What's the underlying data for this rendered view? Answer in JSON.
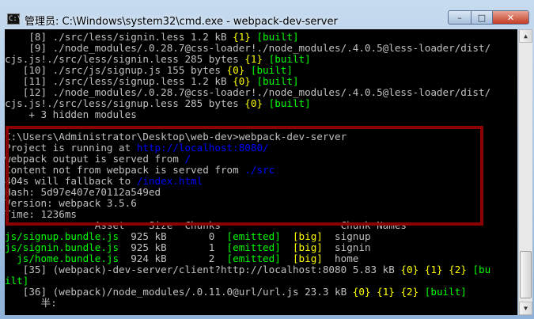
{
  "window": {
    "title": "管理员: C:\\Windows\\system32\\cmd.exe - webpack-dev-server"
  },
  "controls": {
    "minimize": "–",
    "maximize": "□",
    "close": "✕"
  },
  "icons": {
    "cmd": "console-icon"
  },
  "console": {
    "lines": [
      {
        "segs": [
          {
            "t": "    [8] ./src/less/signin.less 1.2 kB ",
            "c": "w"
          },
          {
            "t": "{1}",
            "c": "y"
          },
          {
            "t": " ",
            "c": "w"
          },
          {
            "t": "[built]",
            "c": "g"
          }
        ]
      },
      {
        "segs": [
          {
            "t": "    [9] ./node_modules/.0.28.7@css-loader!./node_modules/.4.0.5@less-loader/dist/",
            "c": "w"
          }
        ]
      },
      {
        "segs": [
          {
            "t": "cjs.js!./src/less/signin.less 285 bytes ",
            "c": "w"
          },
          {
            "t": "{1}",
            "c": "y"
          },
          {
            "t": " ",
            "c": "w"
          },
          {
            "t": "[built]",
            "c": "g"
          }
        ]
      },
      {
        "segs": [
          {
            "t": "   [10] ./src/js/signup.js 155 bytes ",
            "c": "w"
          },
          {
            "t": "{0}",
            "c": "y"
          },
          {
            "t": " ",
            "c": "w"
          },
          {
            "t": "[built]",
            "c": "g"
          }
        ]
      },
      {
        "segs": [
          {
            "t": "   [11] ./src/less/signup.less 1.2 kB ",
            "c": "w"
          },
          {
            "t": "{0}",
            "c": "y"
          },
          {
            "t": " ",
            "c": "w"
          },
          {
            "t": "[built]",
            "c": "g"
          }
        ]
      },
      {
        "segs": [
          {
            "t": "   [12] ./node_modules/.0.28.7@css-loader!./node_modules/.4.0.5@less-loader/dist/",
            "c": "w"
          }
        ]
      },
      {
        "segs": [
          {
            "t": "cjs.js!./src/less/signup.less 285 bytes ",
            "c": "w"
          },
          {
            "t": "{0}",
            "c": "y"
          },
          {
            "t": " ",
            "c": "w"
          },
          {
            "t": "[built]",
            "c": "g"
          }
        ]
      },
      {
        "segs": [
          {
            "t": "    + 3 hidden modules",
            "c": "w"
          }
        ]
      },
      {
        "segs": [
          {
            "t": "",
            "c": "w"
          }
        ]
      },
      {
        "segs": [
          {
            "t": "C:\\Users\\Administrator\\Desktop\\web-dev>webpack-dev-server",
            "c": "w"
          }
        ]
      },
      {
        "segs": [
          {
            "t": "Project is running at ",
            "c": "w"
          },
          {
            "t": "http://localhost:8080/",
            "c": "b"
          }
        ]
      },
      {
        "segs": [
          {
            "t": "webpack output is served from ",
            "c": "w"
          },
          {
            "t": "/",
            "c": "b"
          }
        ]
      },
      {
        "segs": [
          {
            "t": "Content not from webpack is served from ",
            "c": "w"
          },
          {
            "t": "./src",
            "c": "b"
          }
        ]
      },
      {
        "segs": [
          {
            "t": "404s will fallback to ",
            "c": "w"
          },
          {
            "t": "/index.html",
            "c": "b"
          }
        ]
      },
      {
        "segs": [
          {
            "t": "Hash: 5d97e407e70112a549ed",
            "c": "w"
          }
        ]
      },
      {
        "segs": [
          {
            "t": "Version: webpack 3.5.6",
            "c": "w"
          }
        ]
      },
      {
        "segs": [
          {
            "t": "Time: 1236ms",
            "c": "w"
          }
        ]
      },
      {
        "segs": [
          {
            "t": "               Asset    Size  Chunks                    Chunk Names",
            "c": "w"
          }
        ]
      },
      {
        "segs": [
          {
            "t": "js/signup.bundle.js",
            "c": "g"
          },
          {
            "t": "  925 kB       0  ",
            "c": "w"
          },
          {
            "t": "[emitted]",
            "c": "g"
          },
          {
            "t": "  ",
            "c": "w"
          },
          {
            "t": "[big]",
            "c": "y"
          },
          {
            "t": "  signup",
            "c": "w"
          }
        ]
      },
      {
        "segs": [
          {
            "t": "js/signin.bundle.js",
            "c": "g"
          },
          {
            "t": "  925 kB       1  ",
            "c": "w"
          },
          {
            "t": "[emitted]",
            "c": "g"
          },
          {
            "t": "  ",
            "c": "w"
          },
          {
            "t": "[big]",
            "c": "y"
          },
          {
            "t": "  signin",
            "c": "w"
          }
        ]
      },
      {
        "segs": [
          {
            "t": "  js/home.bundle.js",
            "c": "g"
          },
          {
            "t": "  924 kB       2  ",
            "c": "w"
          },
          {
            "t": "[emitted]",
            "c": "g"
          },
          {
            "t": "  ",
            "c": "w"
          },
          {
            "t": "[big]",
            "c": "y"
          },
          {
            "t": "  home",
            "c": "w"
          }
        ]
      },
      {
        "segs": [
          {
            "t": "   [35] (webpack)-dev-server/client?http://localhost:8080 5.83 kB ",
            "c": "w"
          },
          {
            "t": "{0}",
            "c": "y"
          },
          {
            "t": " ",
            "c": "w"
          },
          {
            "t": "{1}",
            "c": "y"
          },
          {
            "t": " ",
            "c": "w"
          },
          {
            "t": "{2}",
            "c": "y"
          },
          {
            "t": " ",
            "c": "w"
          },
          {
            "t": "[bu",
            "c": "g"
          }
        ]
      },
      {
        "segs": [
          {
            "t": "ilt]",
            "c": "g"
          }
        ]
      },
      {
        "segs": [
          {
            "t": "   [36] (webpack)/node_modules/.0.11.0@url/url.js 23.3 kB ",
            "c": "w"
          },
          {
            "t": "{0}",
            "c": "y"
          },
          {
            "t": " ",
            "c": "w"
          },
          {
            "t": "{1}",
            "c": "y"
          },
          {
            "t": " ",
            "c": "w"
          },
          {
            "t": "{2}",
            "c": "y"
          },
          {
            "t": " ",
            "c": "w"
          },
          {
            "t": "[built]",
            "c": "g"
          }
        ]
      },
      {
        "segs": [
          {
            "t": "      半:",
            "c": "w"
          }
        ]
      }
    ]
  },
  "colors": {
    "g": "#00ff00",
    "y": "#ffff00",
    "b": "#0000ff",
    "w": "#c0c0c0",
    "highlight": "#8b0000"
  }
}
